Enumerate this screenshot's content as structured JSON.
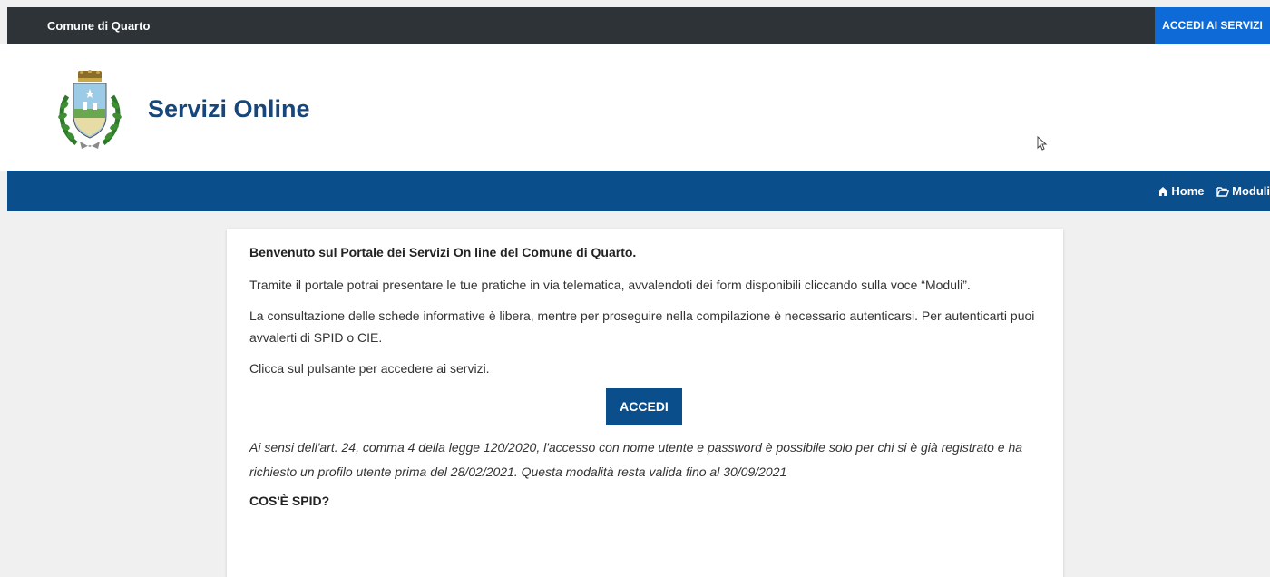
{
  "topbar": {
    "org_name": "Comune di Quarto",
    "login_button": "ACCEDI AI SERVIZI"
  },
  "header": {
    "site_title": "Servizi Online"
  },
  "nav": {
    "items": [
      {
        "label": "Home",
        "icon": "home-icon"
      },
      {
        "label": "Moduli",
        "icon": "folder-open-icon"
      }
    ]
  },
  "content": {
    "welcome": "Benvenuto sul Portale dei Servizi On line del Comune di Quarto.",
    "paragraphs": [
      "Tramite il portale potrai presentare le tue pratiche in via telematica, avvalendoti dei form disponibili cliccando sulla voce “Moduli”.",
      "La consultazione delle schede informative è libera, mentre per proseguire nella compilazione è necessario autenticarsi. Per autenticarti puoi avvalerti di SPID o CIE.",
      "Clicca sul pulsante per accedere ai servizi."
    ],
    "accedi_button": "ACCEDI",
    "note": "Ai sensi dell'art. 24, comma 4 della legge 120/2020, l'accesso con nome utente e password è possibile solo per chi si è già registrato e ha richiesto un profilo utente prima del 28/02/2021. Questa modalità resta valida fino al 30/09/2021",
    "spid_heading": "COS'È SPID?"
  },
  "colors": {
    "topbar_bg": "#2e3338",
    "login_button_bg": "#0d6ad6",
    "navbar_bg": "#0b4e8c",
    "title_color": "#17467a",
    "button_bg": "#0b4e8c"
  }
}
